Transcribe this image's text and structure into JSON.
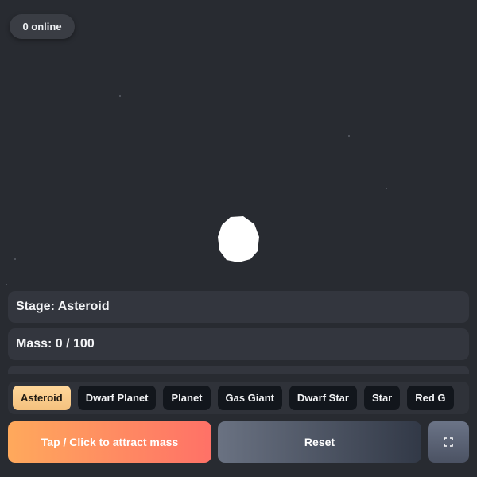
{
  "header": {
    "online_label": "0 online"
  },
  "status": {
    "stage_label": "Stage: Asteroid",
    "mass_label": "Mass: 0 / 100",
    "progress_fraction": 0
  },
  "stages": [
    {
      "label": "Asteroid",
      "active": true
    },
    {
      "label": "Dwarf Planet",
      "active": false
    },
    {
      "label": "Planet",
      "active": false
    },
    {
      "label": "Gas Giant",
      "active": false
    },
    {
      "label": "Dwarf Star",
      "active": false
    },
    {
      "label": "Star",
      "active": false
    },
    {
      "label": "Red G",
      "active": false
    }
  ],
  "controls": {
    "attract_label": "Tap / Click to attract mass",
    "reset_label": "Reset",
    "fullscreen_icon": "fullscreen-icon"
  },
  "colors": {
    "background": "#282b31",
    "accent": "#ffb868",
    "attract_start": "#ffa95c",
    "attract_end": "#ff7167"
  }
}
